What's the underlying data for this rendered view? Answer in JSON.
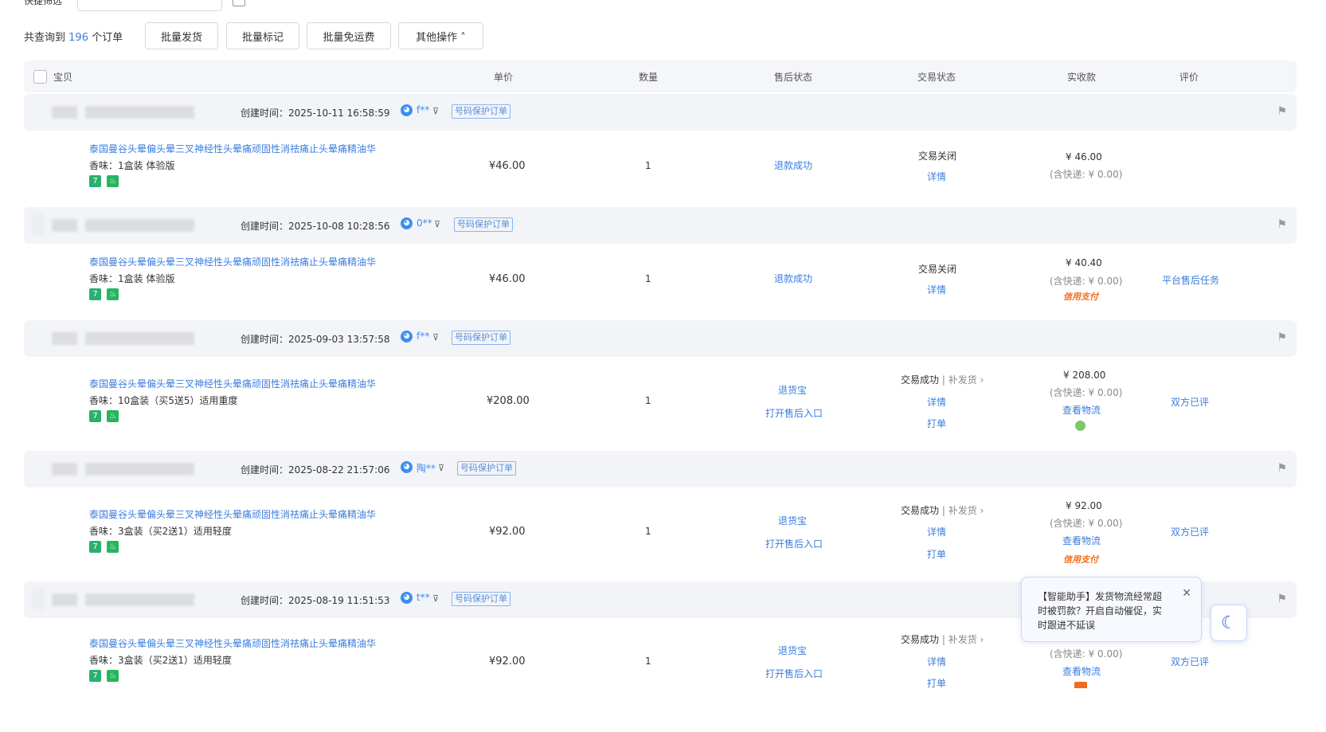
{
  "top": {
    "filter_label": "快捷筛选"
  },
  "summary": {
    "prefix": "共查询到",
    "count": "196",
    "suffix": "个订单"
  },
  "toolbar": {
    "batch_ship": "批量发货",
    "batch_mark": "批量标记",
    "batch_free_shipping": "批量免运费",
    "other_ops": "其他操作 ˄"
  },
  "columns": {
    "item": "宝贝",
    "unit_price": "单价",
    "qty": "数量",
    "aftersale": "售后状态",
    "trade": "交易状态",
    "received": "实收款",
    "review": "评价"
  },
  "common": {
    "ctime_prefix": "创建时间：",
    "tag": "号码保护订单",
    "title": "泰国曼谷头晕偏头晕三叉神经性头晕痛顽固性消祛痛止头晕痛精油华",
    "details": "详情",
    "print": "打单",
    "view_logistics": "查看物流",
    "reship": "补发货",
    "credit_pay": "信用支付",
    "refund_treasure": "退货宝",
    "open_aftersale": "打开售后入口",
    "both_reviewed": "双方已评"
  },
  "orders": [
    {
      "ctime": "2025-10-11 16:58:59",
      "buyer": "f**",
      "variant": "香味：1盒装 体验版",
      "price": "¥46.00",
      "qty": "1",
      "aftersale": "退款成功",
      "trade": "交易关闭",
      "received": "¥ 46.00",
      "shipping": "(含快递: ¥ 0.00)",
      "review": ""
    },
    {
      "ctime": "2025-10-08 10:28:56",
      "buyer": "0**",
      "variant": "香味：1盒装 体验版",
      "price": "¥46.00",
      "qty": "1",
      "aftersale": "退款成功",
      "trade": "交易关闭",
      "received": "¥ 40.40",
      "shipping": "(含快递: ¥ 0.00)",
      "review": "平台售后任务"
    },
    {
      "ctime": "2025-09-03 13:57:58",
      "buyer": "f**",
      "variant": "香味：10盒装（买5送5）适用重度",
      "price": "¥208.00",
      "qty": "1",
      "trade": "交易成功",
      "received": "¥ 208.00",
      "shipping": "(含快递: ¥ 0.00)"
    },
    {
      "ctime": "2025-08-22 21:57:06",
      "buyer": "陶**",
      "variant": "香味：3盒装（买2送1）适用轻度",
      "price": "¥92.00",
      "qty": "1",
      "trade": "交易成功",
      "received": "¥ 92.00",
      "shipping": "(含快递: ¥ 0.00)"
    },
    {
      "ctime": "2025-08-19 11:51:53",
      "buyer": "t**",
      "variant": "香味：3盒装（买2送1）适用轻度",
      "price": "¥92.00",
      "qty": "1",
      "trade": "交易成功",
      "received": "",
      "shipping": "(含快递: ¥ 0.00)"
    }
  ],
  "helper": {
    "text": "【智能助手】发货物流经常超时被罚款？开启自动催促，实时跟进不延误"
  }
}
